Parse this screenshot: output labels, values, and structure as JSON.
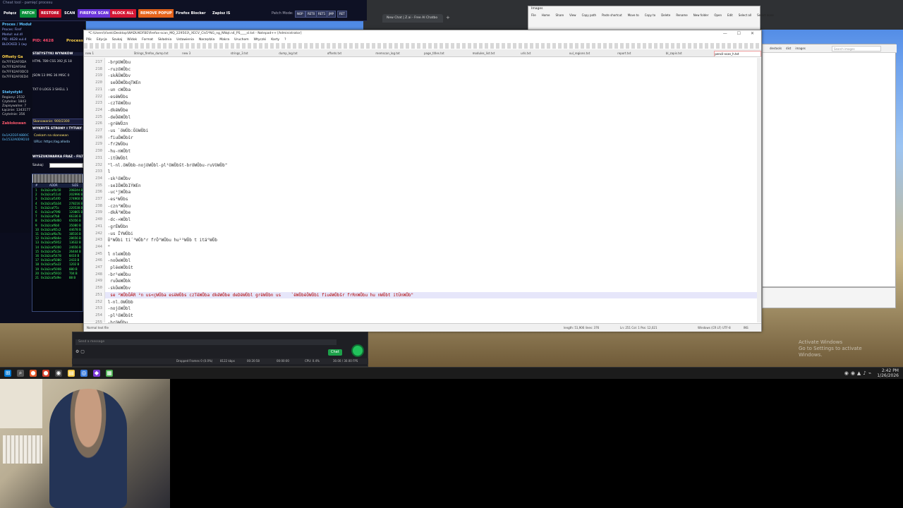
{
  "tool": {
    "title": "Cheat tool - pamięć procesu",
    "buttons": [
      {
        "label": "Połącz",
        "color": "#0e1124"
      },
      {
        "label": "PATCH",
        "color": "#0a8f3a"
      },
      {
        "label": "RESTORE",
        "color": "#c0102a"
      },
      {
        "label": "SCAN",
        "color": "#0e1124"
      },
      {
        "label": "FIREFOX SCAN",
        "color": "#6b35d9"
      },
      {
        "label": "BLOCK ALL",
        "color": "#d41835"
      },
      {
        "label": "REMOVE POPUP",
        "color": "#e5641b"
      },
      {
        "label": "Firefox Blocker",
        "color": "#0e1124"
      },
      {
        "label": "Zapisz IS",
        "color": "#0e1124"
      }
    ],
    "patch_mode_label": "Patch Mode:",
    "hotkeys": [
      "NOP",
      "RET0",
      "RET1",
      "JMP",
      "RET"
    ],
    "proc_heading": "Proces / Moduł",
    "proc_lines": [
      "Proces: Firef",
      "Moduł: xul.dl",
      "PID: 4628 xul.d",
      "BLOCKED 1 (wy"
    ],
    "offsets_heading": "Offsety Ga",
    "offsets": [
      "0x7FF62AF0DA",
      "0x7FF62AF0A4",
      "0x7FF62AF0DC0",
      "0x7FF62AF0ED4"
    ],
    "stats_heading": "Statystyki",
    "stats_lines": [
      "Regiony: 2532",
      "Czytelne: 1843",
      "Zapisywalne: 7",
      "Łącznie: 1343177",
      "Czytelnie: 356"
    ],
    "blocked_heading": "Zablokowan",
    "blocked_lines": [
      "0x1A2D3F48B0C",
      "0x1532A0D9D10"
    ],
    "pid_label": "PID: 4628",
    "process_label": "Process",
    "stats_header": "STATYSTYKI WYNIKÓW",
    "stats_rows": [
      "HTML 7B9 CSS 392 JS 18",
      "JSON 13 IMG 36 MISC 0",
      "TXT 0 LOGS 3 SHELL 1"
    ],
    "scan_progress": "Skanowanie: 900/2300",
    "page_header": "WYKRYTE STRONY I TYTUŁY",
    "page_lines": [
      "Czekam na skanowan",
      "URLs: https://ag.alloda"
    ],
    "search_header": "WYSZUKIWARKA FRAZ - FILTRU",
    "search_label": "Szukaj:",
    "search_value": "",
    "table_headers": [
      "#",
      "ADDR",
      "SIZE"
    ],
    "table_rows": [
      [
        "1",
        "0x1b2caf0c50",
        "208244 B"
      ],
      [
        "2",
        "0x1b2caf11c0",
        "202996 B"
      ],
      [
        "3",
        "0x1b2caf14f0",
        "274960 B"
      ],
      [
        "4",
        "0x1b2caf1b34",
        "278216 B"
      ],
      [
        "5",
        "0x1b2caf75c",
        "220538 B"
      ],
      [
        "6",
        "0x1b2caf79f8",
        "120865 B"
      ],
      [
        "7",
        "0x1b2caf7b8",
        "66336 B"
      ],
      [
        "8",
        "0x1b2caf6d60",
        "65056 B"
      ],
      [
        "9",
        "0x1b2caf6b0",
        "35080 B"
      ],
      [
        "10",
        "0x1b2caf65c2",
        "44678 B"
      ],
      [
        "11",
        "0x1b2caf6a7b",
        "38516 B"
      ],
      [
        "12",
        "0x1b2caf6b6e",
        "28656 B"
      ],
      [
        "13",
        "0x1b2caf5952",
        "13632 B"
      ],
      [
        "14",
        "0x1b2caf5000",
        "24656 B"
      ],
      [
        "15",
        "0x1b2caf5c2e",
        "26444 B"
      ],
      [
        "16",
        "0x1b2caf5478",
        "8410 B"
      ],
      [
        "17",
        "0x1b2caf5080",
        "2433 B"
      ],
      [
        "18",
        "0x1b2caf5a22",
        "1202 B"
      ],
      [
        "19",
        "0x1b2caf5008",
        "880 B"
      ],
      [
        "20",
        "0x1b2caf5910",
        "704 B"
      ],
      [
        "21",
        "0x1b2caf5d9e",
        "88 B"
      ]
    ]
  },
  "editor": {
    "title": "*C:\\Users\\Vivek\\Desktop\\WADUKOFBE\\firefox-scan_MQ_229503\\_XECV_Cls5*NG_ng_NNqt.n4_PS____sl.txt - Notepad++ [Administrator]",
    "menu": [
      "Plik",
      "Edycja",
      "Szukaj",
      "Widok",
      "Format",
      "Składnia",
      "Ustawienia",
      "Narzędzia",
      "Makra",
      "Uruchom",
      "Wtyczki",
      "Karty",
      "?"
    ],
    "tabs": [
      "new 1",
      "Strings_firefox_dump.txt",
      "new 3",
      "strings_3.txt",
      "dump_log.txt",
      "offsets.txt",
      "memscan_log.txt",
      "page_titles.txt",
      "modules_list.txt",
      "urls.txt",
      "xul_regions.txt",
      "report.txt",
      "bl_zapis.txt",
      "pencil-scan_h.txt"
    ],
    "lines": [
      {
        "n": "217",
        "t": " -brpUWÖbu"
      },
      {
        "n": "218",
        "t": " -ruzöWÖbc"
      },
      {
        "n": "219",
        "t": " -skÄÜWÖbv"
      },
      {
        "n": "220",
        "t": "  seÖÖWÖbqTWEn"
      },
      {
        "n": "221",
        "t": " -un cWÖba"
      },
      {
        "n": "222",
        "t": " -esëWÖbs"
      },
      {
        "n": "223",
        "t": " -czTêWÖbu"
      },
      {
        "n": "224",
        "t": " -dkëWÖbe"
      },
      {
        "n": "225",
        "t": " -deÖëWÖbl"
      },
      {
        "n": "226",
        "t": " -grëWÖzn"
      },
      {
        "n": "227",
        "t": " -us `öWÖb:ÖöWÖbi"
      },
      {
        "n": "228",
        "t": " -fiuÖWÖbšr"
      },
      {
        "n": "229",
        "t": " -fr2WÖbu"
      },
      {
        "n": "230",
        "t": " -hu-nWÖbt"
      },
      {
        "n": "231",
        "t": " -itÜWÖbl"
      },
      {
        "n": "232",
        "t": " \"l-nl.öWÖbb-nojöWÖbl-pl²öWÖbšt-bröWÖbu-ruVöWÖb\""
      },
      {
        "n": "233",
        "t": " l"
      },
      {
        "n": "234",
        "t": " -sk²öWÖbv"
      },
      {
        "n": "235",
        "t": " -seIÖWÖbIÝWEn"
      },
      {
        "n": "236",
        "t": " -uc¹jWÖba"
      },
      {
        "n": "237",
        "t": " -es²WÖbs"
      },
      {
        "n": "238",
        "t": " -czn³WÖbu"
      },
      {
        "n": "239",
        "t": " -dkÄ³WÖbe"
      },
      {
        "n": "240",
        "t": " -dc-»WÖbl"
      },
      {
        "n": "241",
        "t": " -grÉWÖbn"
      },
      {
        "n": "242",
        "t": " -us ÏYWÖbi"
      },
      {
        "n": "243",
        "t": " Ü°WÖbi ti´³WÖb\"r frÖ°WÖbu hu²³WÖb t itä°WÖb"
      },
      {
        "n": "244",
        "t": " \""
      },
      {
        "n": "245",
        "t": " l nleWÖbb"
      },
      {
        "n": "246",
        "t": " -noÖeWÖbl"
      },
      {
        "n": "247",
        "t": "  plëeWÖbšt"
      },
      {
        "n": "248",
        "t": " -br²eWÖbu"
      },
      {
        "n": "249",
        "t": "  ruÖeWÖbk"
      },
      {
        "n": "250",
        "t": " -skÖeWÖbv"
      },
      {
        "n": "251",
        "t": "  se ²WÖbÖÄR ²n us<çWÖba esëWÖbs czTëWÖba dkëWÖbe deDëWÖbl grëWÖbn us    `ëWÖbëÖWÖbi fiuëWÖbšr frRnWÖbu hu nWÖbt itÜnWÖb\""
      },
      {
        "n": "252",
        "t": " l-nl.öWÖbb"
      },
      {
        "n": "253",
        "t": " -nojöWÖbl"
      },
      {
        "n": "254",
        "t": " -pl²öWÖbšt"
      },
      {
        "n": "255",
        "t": " -bröWÖbu"
      }
    ],
    "highlight_line": "251",
    "status": [
      "Normal text file",
      "length: 51,906   lines: 376",
      "Ln: 251   Col: 1   Pos: 12,021",
      "Windows (CR LF)",
      "UTF-8",
      "INS"
    ]
  },
  "browser": {
    "tab_label": "New Chat | Z.ai - Free AI Chatbo",
    "plus": "+"
  },
  "explorer": {
    "title": "Images",
    "ribbon": [
      "File",
      "Home",
      "Share",
      "View",
      "Copy path",
      "Paste shortcut",
      "Move to",
      "Copy to",
      "Delete",
      "Rename",
      "New folder",
      "Open",
      "Edit",
      "Select all",
      "Select none"
    ]
  },
  "devtools": {
    "tabs": [
      "devtools",
      "dist",
      "images"
    ],
    "search_placeholder": "Search images"
  },
  "obs": {
    "message_placeholder": "Send a message",
    "chat_label": "Chat",
    "stats": [
      "Dropped Frames 0 (0.0%)",
      "8122 kbps",
      "00:20:58",
      "00:00:00",
      "CPU: 0.4%",
      "30.00 / 30.00 FPS"
    ]
  },
  "taskbar": {
    "clock_time": "2:42 PM",
    "clock_date": "1/26/2026"
  },
  "watermark": [
    "Activate Windows",
    "Go to Settings to activate Windows."
  ]
}
